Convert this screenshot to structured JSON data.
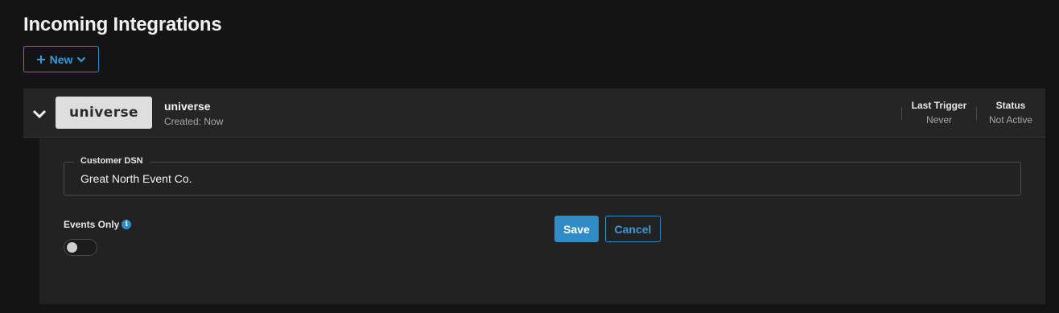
{
  "page": {
    "title": "Incoming Integrations",
    "new_button_label": "New"
  },
  "integration": {
    "logo_text": "universe",
    "name": "universe",
    "created": "Created: Now",
    "last_trigger_label": "Last Trigger",
    "last_trigger_value": "Never",
    "status_label": "Status",
    "status_value": "Not Active",
    "form": {
      "dsn_label": "Customer DSN",
      "dsn_value": "Great North Event Co.",
      "events_only_label": "Events Only",
      "events_only_enabled": false,
      "save_label": "Save",
      "cancel_label": "Cancel"
    }
  },
  "colors": {
    "accent": "#2f8cc4",
    "background": "#141414",
    "panel": "#252525"
  },
  "icons": {
    "new": [
      "plus-icon",
      "chevron-down-icon"
    ],
    "expand": "chevron-down-icon",
    "info": "info-icon"
  }
}
